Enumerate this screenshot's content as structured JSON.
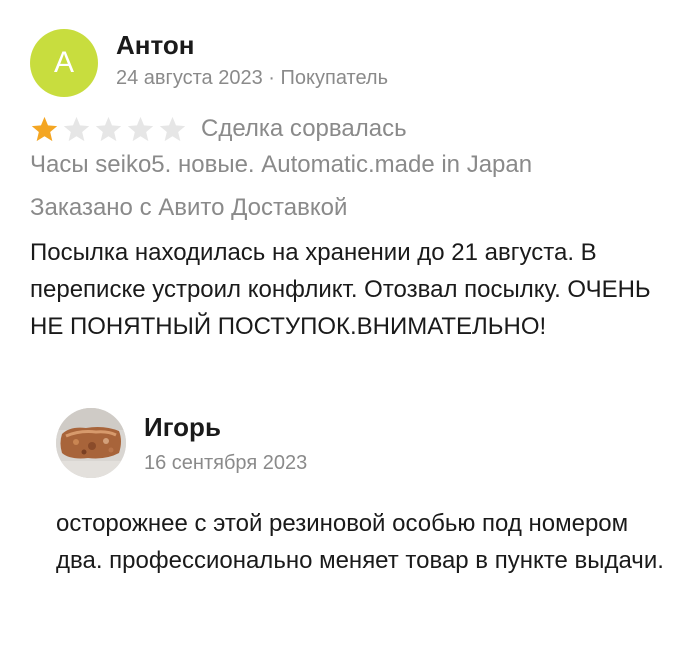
{
  "review": {
    "author": {
      "initial": "А",
      "name": "Антон",
      "avatar_color": "#c8dd3e"
    },
    "date": "24 августа 2023",
    "separator": "·",
    "role": "Покупатель",
    "rating": {
      "value": 1,
      "max": 5,
      "filled_color": "#f4a623",
      "empty_color": "#e6e6e6"
    },
    "status": "Сделка сорвалась",
    "item_title": "Часы seiko5. новые. Automatic.made in Japan",
    "delivery": "Заказано с Авито Доставкой",
    "text": "Посылка находилась на хранении до 21 августа. В переписке устроил конфликт. Отозвал посылку. ОЧЕНЬ НЕ ПОНЯТНЫЙ ПОСТУПОК.ВНИМАТЕЛЬНО!"
  },
  "reply": {
    "author_name": "Игорь",
    "date": "16 сентября 2023",
    "text": "осторожнее с этой резиновой особью под номером два. профессионально меняет товар в пункте выдачи."
  }
}
